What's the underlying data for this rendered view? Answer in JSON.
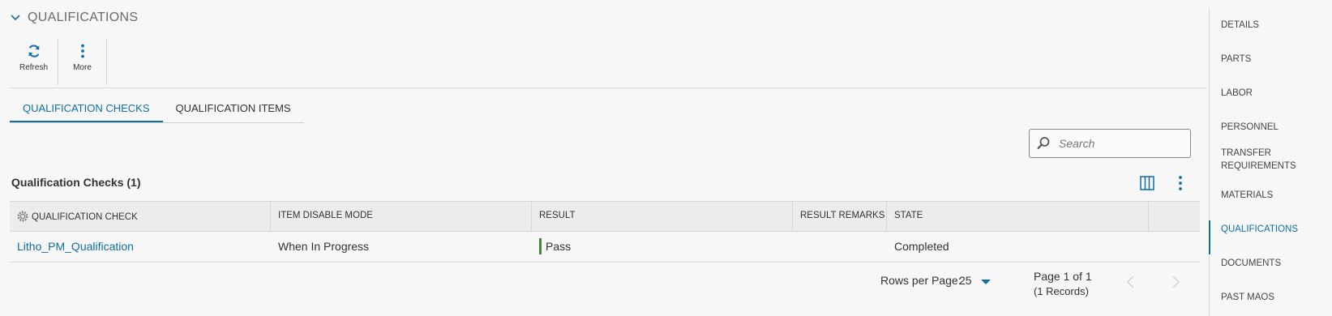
{
  "section": {
    "title": "QUALIFICATIONS"
  },
  "toolbar": {
    "refresh_label": "Refresh",
    "more_label": "More"
  },
  "tabs": [
    {
      "label": "QUALIFICATION CHECKS",
      "active": true
    },
    {
      "label": "QUALIFICATION ITEMS",
      "active": false
    }
  ],
  "search": {
    "placeholder": "Search",
    "value": ""
  },
  "grid": {
    "title": "Qualification Checks (1)",
    "columns": [
      "QUALIFICATION CHECK",
      "ITEM DISABLE MODE",
      "RESULT",
      "RESULT REMARKS",
      "STATE"
    ],
    "rows": [
      {
        "qualification_check": "Litho_PM_Qualification",
        "item_disable_mode": "When In Progress",
        "result": "Pass",
        "result_remarks": "",
        "state": "Completed"
      }
    ]
  },
  "pager": {
    "rows_per_page_label": "Rows per Page:",
    "rows_per_page_value": "25",
    "page_text": "Page 1 of 1",
    "records_text": "(1 Records)"
  },
  "right_nav": {
    "items": [
      "DETAILS",
      "PARTS",
      "LABOR",
      "PERSONNEL",
      "TRANSFER REQUIREMENTS",
      "MATERIALS",
      "QUALIFICATIONS",
      "DOCUMENTS",
      "PAST MAOS"
    ],
    "active": "QUALIFICATIONS"
  },
  "colors": {
    "accent": "#0f6fa8",
    "pass": "#3f8b3f",
    "background": "#f7f7f7"
  },
  "icons": [
    "chevron-down-icon",
    "refresh-icon",
    "more-vertical-icon",
    "search-icon",
    "settings-gear-icon",
    "columns-icon",
    "kebab-menu-icon",
    "caret-down-icon",
    "chevron-left-icon",
    "chevron-right-icon"
  ]
}
